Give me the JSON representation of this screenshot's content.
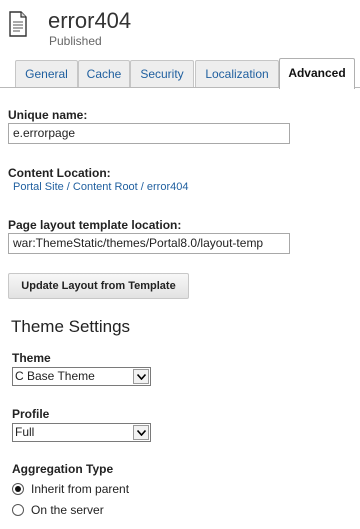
{
  "header": {
    "title": "error404",
    "status": "Published",
    "icon": "document-icon"
  },
  "tabs": [
    {
      "label": "General",
      "active": false
    },
    {
      "label": "Cache",
      "active": false
    },
    {
      "label": "Security",
      "active": false
    },
    {
      "label": "Localization",
      "active": false
    },
    {
      "label": "Advanced",
      "active": true
    }
  ],
  "unique_name": {
    "label": "Unique name:",
    "value": "e.errorpage"
  },
  "content_location": {
    "label": "Content Location:",
    "link": "Portal Site / Content Root / error404"
  },
  "layout_template": {
    "label": "Page layout template location:",
    "value": "war:ThemeStatic/themes/Portal8.0/layout-temp"
  },
  "update_button": {
    "label": "Update Layout from Template"
  },
  "theme_settings": {
    "heading": "Theme Settings",
    "theme": {
      "label": "Theme",
      "selected": "C Base Theme"
    },
    "profile": {
      "label": "Profile",
      "selected": "Full"
    },
    "aggregation": {
      "label": "Aggregation Type",
      "options": [
        {
          "label": "Inherit from parent",
          "checked": true
        },
        {
          "label": "On the server",
          "checked": false
        }
      ]
    }
  },
  "colors": {
    "link": "#1f5f9f",
    "tab_bg": "#eeeeee"
  }
}
